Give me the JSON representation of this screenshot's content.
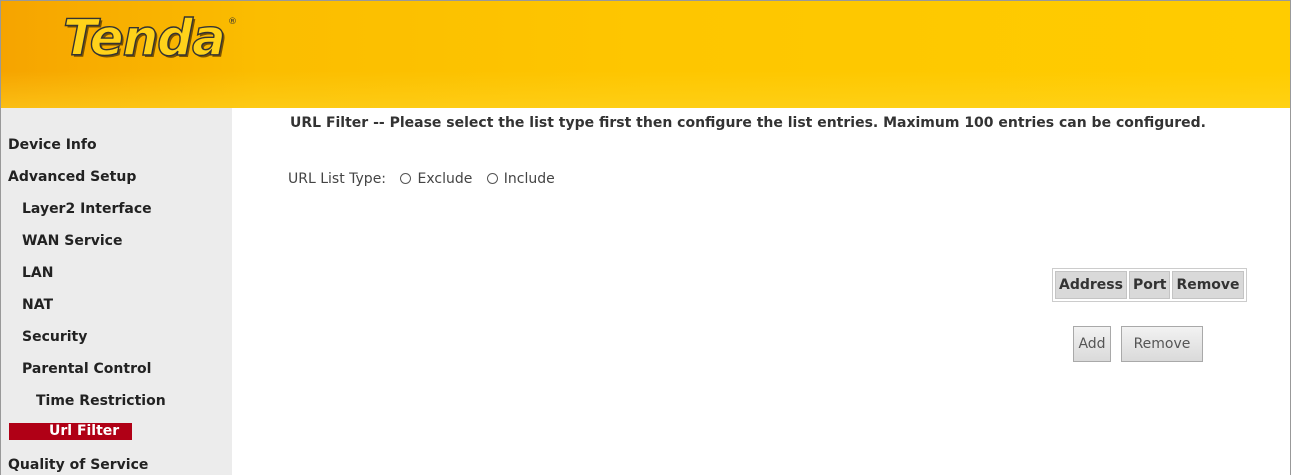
{
  "brand": {
    "logo_text": "Tenda",
    "logo_mark": "®"
  },
  "sidebar": {
    "items": [
      {
        "label": "Device Info"
      },
      {
        "label": "Advanced Setup"
      },
      {
        "label": "Layer2 Interface"
      },
      {
        "label": "WAN Service"
      },
      {
        "label": "LAN"
      },
      {
        "label": "NAT"
      },
      {
        "label": "Security"
      },
      {
        "label": "Parental Control"
      },
      {
        "label": "Time Restriction"
      },
      {
        "label": "Url Filter"
      },
      {
        "label": "Quality of Service"
      }
    ],
    "selected": "Url Filter"
  },
  "main": {
    "title": "URL Filter -- Please select the list type first then configure the list entries. Maximum 100 entries can be configured.",
    "list_type_label": "URL List Type:",
    "options": [
      {
        "label": "Exclude"
      },
      {
        "label": "Include"
      }
    ],
    "table_headers": [
      "Address",
      "Port",
      "Remove"
    ],
    "add_button": "Add",
    "remove_button": "Remove"
  },
  "colors": {
    "header": "#ffcc00",
    "sidebar_bg": "#ececec",
    "selected_bg": "#b00016"
  }
}
